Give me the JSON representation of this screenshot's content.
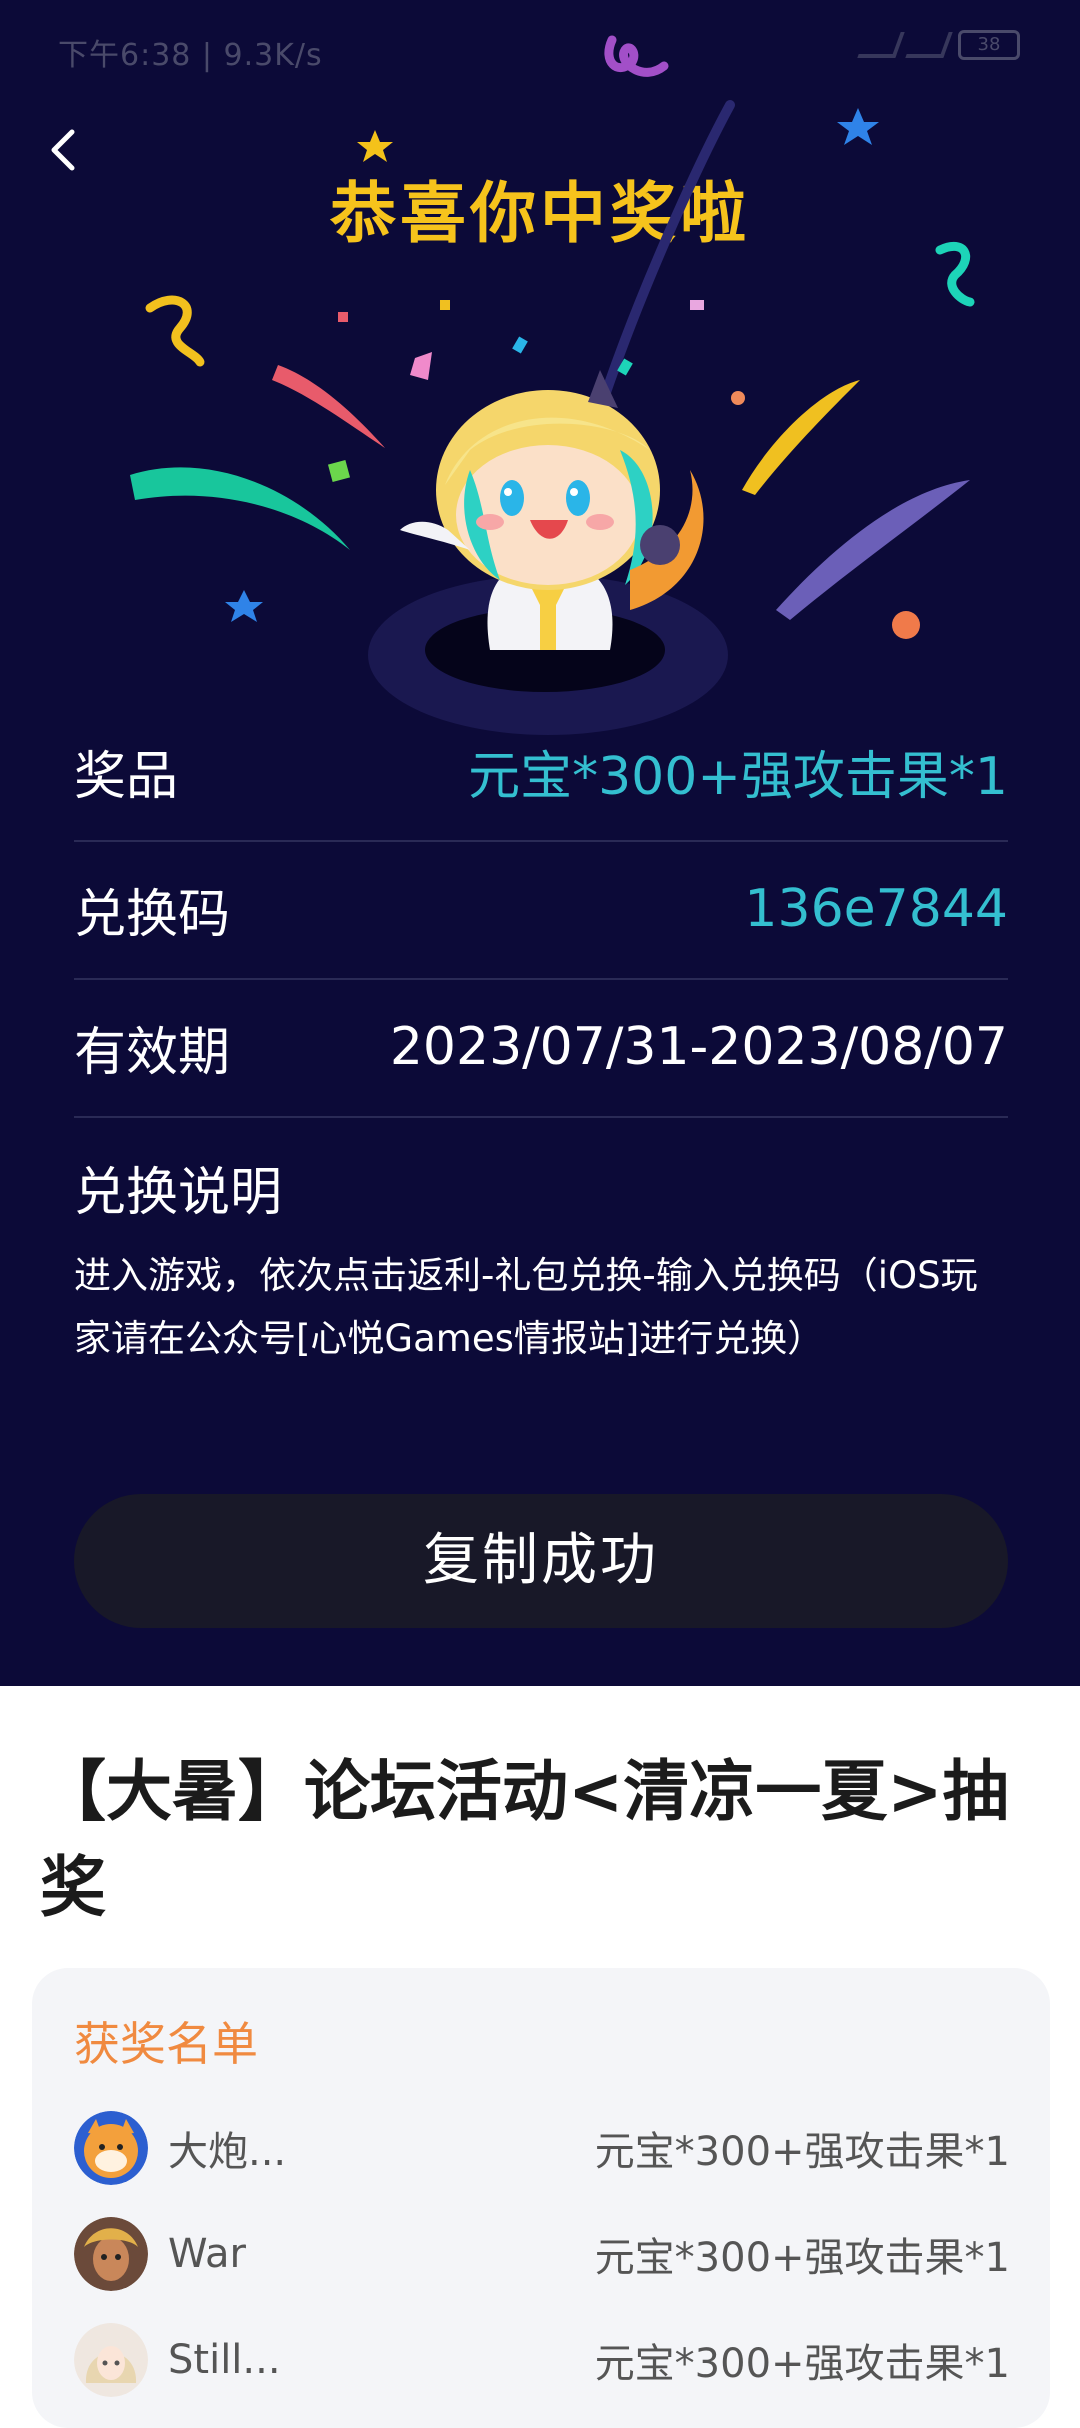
{
  "status_bar": {
    "time_speed": "下午6:38 | 9.3K/s",
    "battery": "38"
  },
  "header": {
    "title": "恭喜你中奖啦"
  },
  "prize_info": {
    "prize_label": "奖品",
    "prize_value": "元宝*300+强攻击果*1",
    "code_label": "兑换码",
    "code_value": "136e7844",
    "validity_label": "有效期",
    "validity_value": "2023/07/31-2023/08/07",
    "instructions_title": "兑换说明",
    "instructions_text": "进入游戏，依次点击返利-礼包兑换-输入兑换码（iOS玩家请在公众号[心悦Games情报站]进行兑换）"
  },
  "copy_button": {
    "label": "复制成功"
  },
  "event": {
    "title": "【大暑】论坛活动<清凉一夏>抽奖"
  },
  "winners": {
    "title": "获奖名单",
    "list": [
      {
        "name": "大炮...",
        "prize": "元宝*300+强攻击果*1"
      },
      {
        "name": "War",
        "prize": "元宝*300+强攻击果*1"
      },
      {
        "name": "Still...",
        "prize": "元宝*300+强攻击果*1"
      }
    ]
  },
  "colors": {
    "background": "#0c0a38",
    "accent_title": "#f6c31c",
    "accent_value": "#34bfd0",
    "winners_title": "#f08a40"
  }
}
